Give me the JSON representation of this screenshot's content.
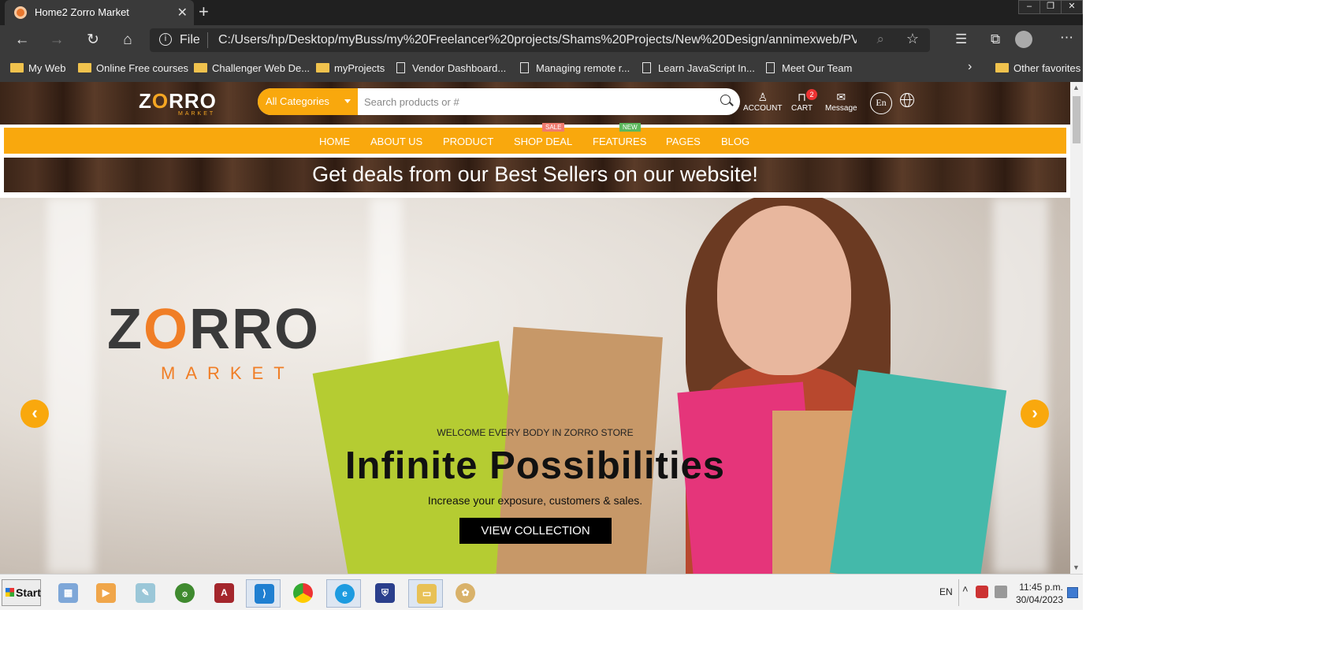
{
  "browser": {
    "tab_title": "Home2 Zorro Market",
    "url_scheme": "File",
    "url": "C:/Users/hp/Desktop/myBuss/my%20Freelancer%20projects/Shams%20Projects/New%20Design/annimexweb/PV/...",
    "favorites": [
      {
        "label": "My Web",
        "type": "folder"
      },
      {
        "label": "Online Free courses",
        "type": "folder"
      },
      {
        "label": "Challenger Web De...",
        "type": "folder"
      },
      {
        "label": "myProjects",
        "type": "folder"
      },
      {
        "label": "Vendor Dashboard...",
        "type": "page"
      },
      {
        "label": "Managing remote r...",
        "type": "page"
      },
      {
        "label": "Learn JavaScript In...",
        "type": "page"
      },
      {
        "label": "Meet Our Team",
        "type": "page"
      }
    ],
    "other_favorites": "Other favorites"
  },
  "site": {
    "logo": {
      "text_a": "Z",
      "text_o": "O",
      "text_b": "RRO",
      "sub": "MARKET"
    },
    "search": {
      "category": "All Categories",
      "placeholder": "Search products or #"
    },
    "header_actions": {
      "account": "ACCOUNT",
      "cart": "CART",
      "cart_count": "2",
      "message": "Message",
      "language": "En"
    },
    "nav": {
      "items": [
        "HOME",
        "ABOUT US",
        "PRODUCT",
        "SHOP DEAL",
        "FEATURES",
        "PAGES",
        "BLOG"
      ],
      "badges": {
        "shop_deal": "SALE",
        "features": "NEW"
      }
    },
    "promo": "Get deals from our Best Sellers on our website!",
    "hero": {
      "logo_a": "Z",
      "logo_o": "O",
      "logo_b": "RRO",
      "logo_sub": "MARKET",
      "kicker": "WELCOME EVERY BODY IN ZORRO STORE",
      "title": "Infinite Possibilities",
      "description": "Increase your exposure, customers & sales.",
      "cta": "VIEW COLLECTION"
    }
  },
  "taskbar": {
    "start": "Start",
    "apps": [
      "calculator",
      "media-player",
      "notepad",
      "quran",
      "access",
      "vs-code",
      "chrome",
      "edge",
      "antivirus",
      "file-explorer",
      "paint"
    ],
    "language": "EN",
    "time": "11:45 p.m.",
    "date": "30/04/2023"
  },
  "colors": {
    "accent": "#f9a80d",
    "logo_orange": "#f07e26",
    "wood": "#3b2518"
  }
}
